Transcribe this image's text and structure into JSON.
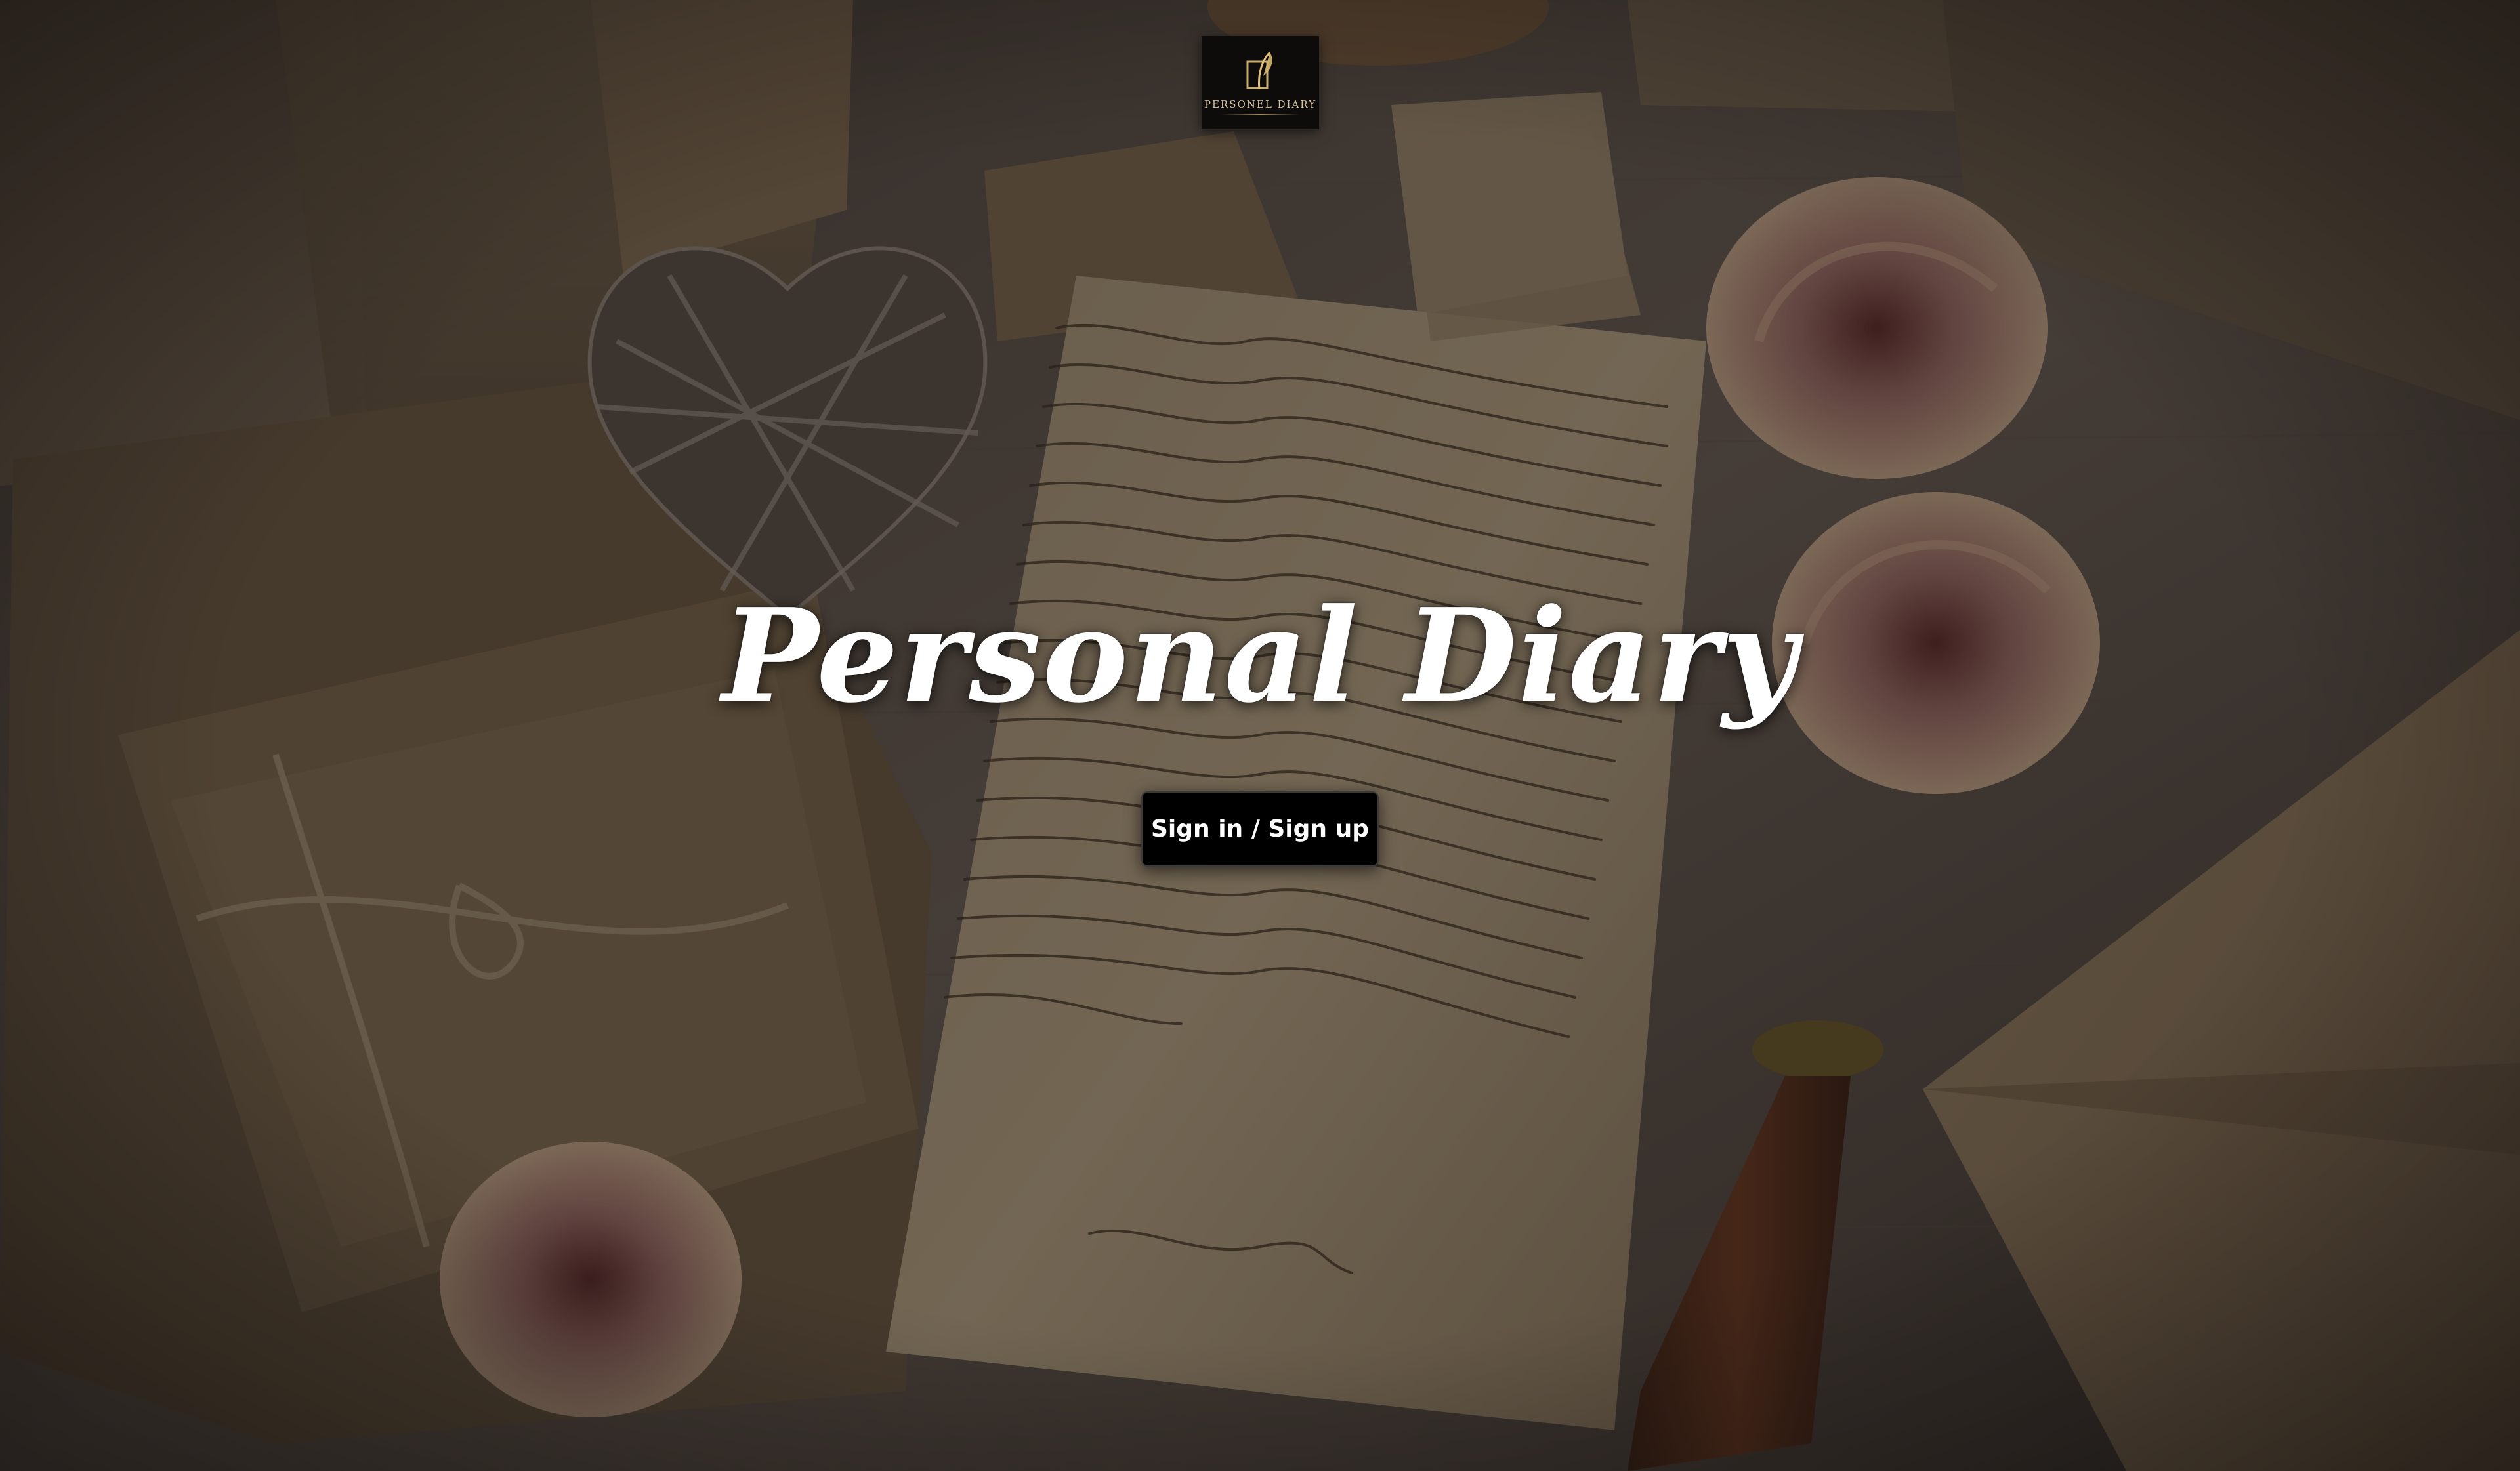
{
  "logo": {
    "name": "PERSONEL DIARY",
    "icon": "quill-book-icon"
  },
  "hero": {
    "title": "Personal Diary",
    "cta_label": "Sign in / Sign up"
  },
  "background": {
    "description_icon": "desk-letter-background-image",
    "colors": {
      "paper": "#c7b28e",
      "desk": "#6d6259",
      "rose": "#b98a86",
      "ink": "#2a2016"
    }
  }
}
